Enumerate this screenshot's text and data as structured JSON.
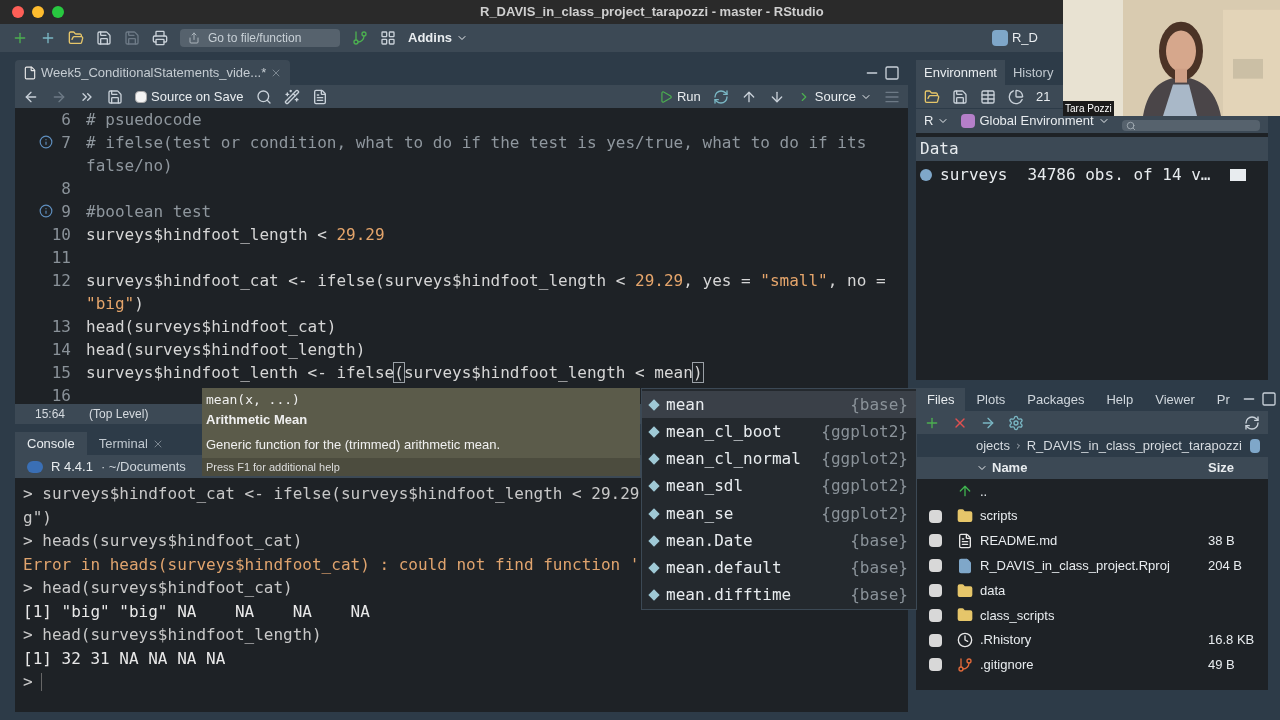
{
  "window": {
    "title": "R_DAVIS_in_class_project_tarapozzi - master - RStudio"
  },
  "toolbar": {
    "goto": "Go to file/function",
    "addins": "Addins",
    "project": "R_D"
  },
  "source": {
    "tab": "Week5_ConditionalStatements_vide...*",
    "source_on_save": {
      "label": "Source on Save",
      "checked": false
    },
    "run": "Run",
    "source": "Source",
    "lines": [
      {
        "num": "6",
        "info": false,
        "tokens": [
          {
            "kind": "comment",
            "text": "# psuedocode"
          }
        ]
      },
      {
        "num": "7",
        "info": true,
        "tokens": [
          {
            "kind": "comment",
            "text": "# ifelse(test or condition, what to do if the test is yes/true, what to do if its false/no)"
          }
        ]
      },
      {
        "num": "8",
        "info": false
      },
      {
        "num": "9",
        "info": true,
        "tokens": [
          {
            "kind": "comment",
            "text": "#boolean test"
          }
        ]
      },
      {
        "num": "10",
        "info": false,
        "tokens": [
          {
            "kind": "plain",
            "text": "surveys$hindfoot_length < "
          },
          {
            "kind": "number",
            "text": "29.29"
          }
        ]
      },
      {
        "num": "11",
        "info": false
      },
      {
        "num": "12",
        "info": false,
        "tokens": [
          {
            "kind": "plain",
            "text": "surveys$hindfoot_cat <- ifelse(surveys$hindfoot_length < "
          },
          {
            "kind": "number",
            "text": "29.29"
          },
          {
            "kind": "plain",
            "text": ", yes = "
          },
          {
            "kind": "string",
            "text": "\"small\""
          },
          {
            "kind": "plain",
            "text": ", no = "
          },
          {
            "kind": "string",
            "text": "\"big\""
          },
          {
            "kind": "plain",
            "text": ")"
          }
        ]
      },
      {
        "num": "13",
        "info": false,
        "tokens": [
          {
            "kind": "plain",
            "text": "head(surveys$hindfoot_cat)"
          }
        ]
      },
      {
        "num": "14",
        "info": false,
        "tokens": [
          {
            "kind": "plain",
            "text": "head(surveys$hindfoot_length)"
          }
        ]
      },
      {
        "num": "15",
        "info": false,
        "tokens": [
          {
            "kind": "plain",
            "text": "surveys$hindfoot_lenth <- ifelse"
          },
          {
            "kind": "bracket",
            "text": "("
          },
          {
            "kind": "plain",
            "text": "surveys$hindfoot_length < mean"
          },
          {
            "kind": "bracket",
            "text": ")"
          }
        ]
      },
      {
        "num": "16",
        "info": false
      }
    ],
    "status": {
      "position": "15:64",
      "scope": "(Top Level)"
    }
  },
  "console": {
    "tabs": [
      {
        "label": "Console",
        "selected": true,
        "closable": false
      },
      {
        "label": "Terminal",
        "selected": false,
        "closable": true
      }
    ],
    "version": "R 4.4.1",
    "path": "· ~/Documents",
    "lines": [
      {
        "kind": "input",
        "text": "> surveys$hindfoot_cat <- ifelse(surveys$hindfoot_length < 29.29"
      },
      {
        "kind": "input",
        "text": "g\")"
      },
      {
        "kind": "input",
        "text": "> heads(surveys$hindfoot_cat)"
      },
      {
        "kind": "error",
        "text": "Error in heads(surveys$hindfoot_cat) : could not find function '"
      },
      {
        "kind": "input",
        "text": "> head(surveys$hindfoot_cat)"
      },
      {
        "kind": "output",
        "text": "[1] \"big\" \"big\" NA    NA    NA    NA"
      },
      {
        "kind": "input",
        "text": "> head(surveys$hindfoot_length)"
      },
      {
        "kind": "output",
        "text": "[1] 32 31 NA NA NA NA"
      },
      {
        "kind": "prompt",
        "text": ">"
      }
    ]
  },
  "environment": {
    "tabs": [
      {
        "label": "Environment",
        "selected": true
      },
      {
        "label": "History",
        "selected": false
      }
    ],
    "memory": "21",
    "language": "R",
    "scope": "Global Environment",
    "section": "Data",
    "rows": [
      {
        "name": "surveys",
        "value": "34786 obs. of 14 v…"
      }
    ]
  },
  "files": {
    "tabs": [
      {
        "label": "Files",
        "selected": true
      },
      {
        "label": "Plots",
        "selected": false
      },
      {
        "label": "Packages",
        "selected": false
      },
      {
        "label": "Help",
        "selected": false
      },
      {
        "label": "Viewer",
        "selected": false
      },
      {
        "label": "Pr",
        "selected": false
      }
    ],
    "path": [
      "ojects",
      "R_DAVIS_in_class_project_tarapozzi"
    ],
    "columns": [
      "Name",
      "Size"
    ],
    "rows": [
      {
        "kind": "up",
        "name": ".."
      },
      {
        "kind": "folder",
        "name": "scripts",
        "checked": false
      },
      {
        "kind": "md",
        "name": "README.md",
        "size": "38 B",
        "checked": false
      },
      {
        "kind": "rproj",
        "name": "R_DAVIS_in_class_project.Rproj",
        "size": "204 B",
        "checked": false
      },
      {
        "kind": "folder",
        "name": "data",
        "checked": false
      },
      {
        "kind": "folder",
        "name": "class_scripts",
        "checked": false
      },
      {
        "kind": "history",
        "name": ".Rhistory",
        "size": "16.8 KB",
        "checked": false
      },
      {
        "kind": "git",
        "name": ".gitignore",
        "size": "49 B",
        "checked": false
      }
    ]
  },
  "tooltip": {
    "signature": "mean(x, ...)",
    "title": "Arithmetic Mean",
    "description": "Generic function for the (trimmed) arithmetic mean.",
    "hint": "Press F1 for additional help"
  },
  "completion": {
    "items": [
      {
        "name": "mean",
        "package": "{base}",
        "selected": true
      },
      {
        "name": "mean_cl_boot",
        "package": "{ggplot2}",
        "selected": false
      },
      {
        "name": "mean_cl_normal",
        "package": "{ggplot2}",
        "selected": false
      },
      {
        "name": "mean_sdl",
        "package": "{ggplot2}",
        "selected": false
      },
      {
        "name": "mean_se",
        "package": "{ggplot2}",
        "selected": false
      },
      {
        "name": "mean.Date",
        "package": "{base}",
        "selected": false
      },
      {
        "name": "mean.default",
        "package": "{base}",
        "selected": false
      },
      {
        "name": "mean.difftime",
        "package": "{base}",
        "selected": false
      }
    ]
  },
  "video": {
    "name": "Tara Pozzi"
  }
}
